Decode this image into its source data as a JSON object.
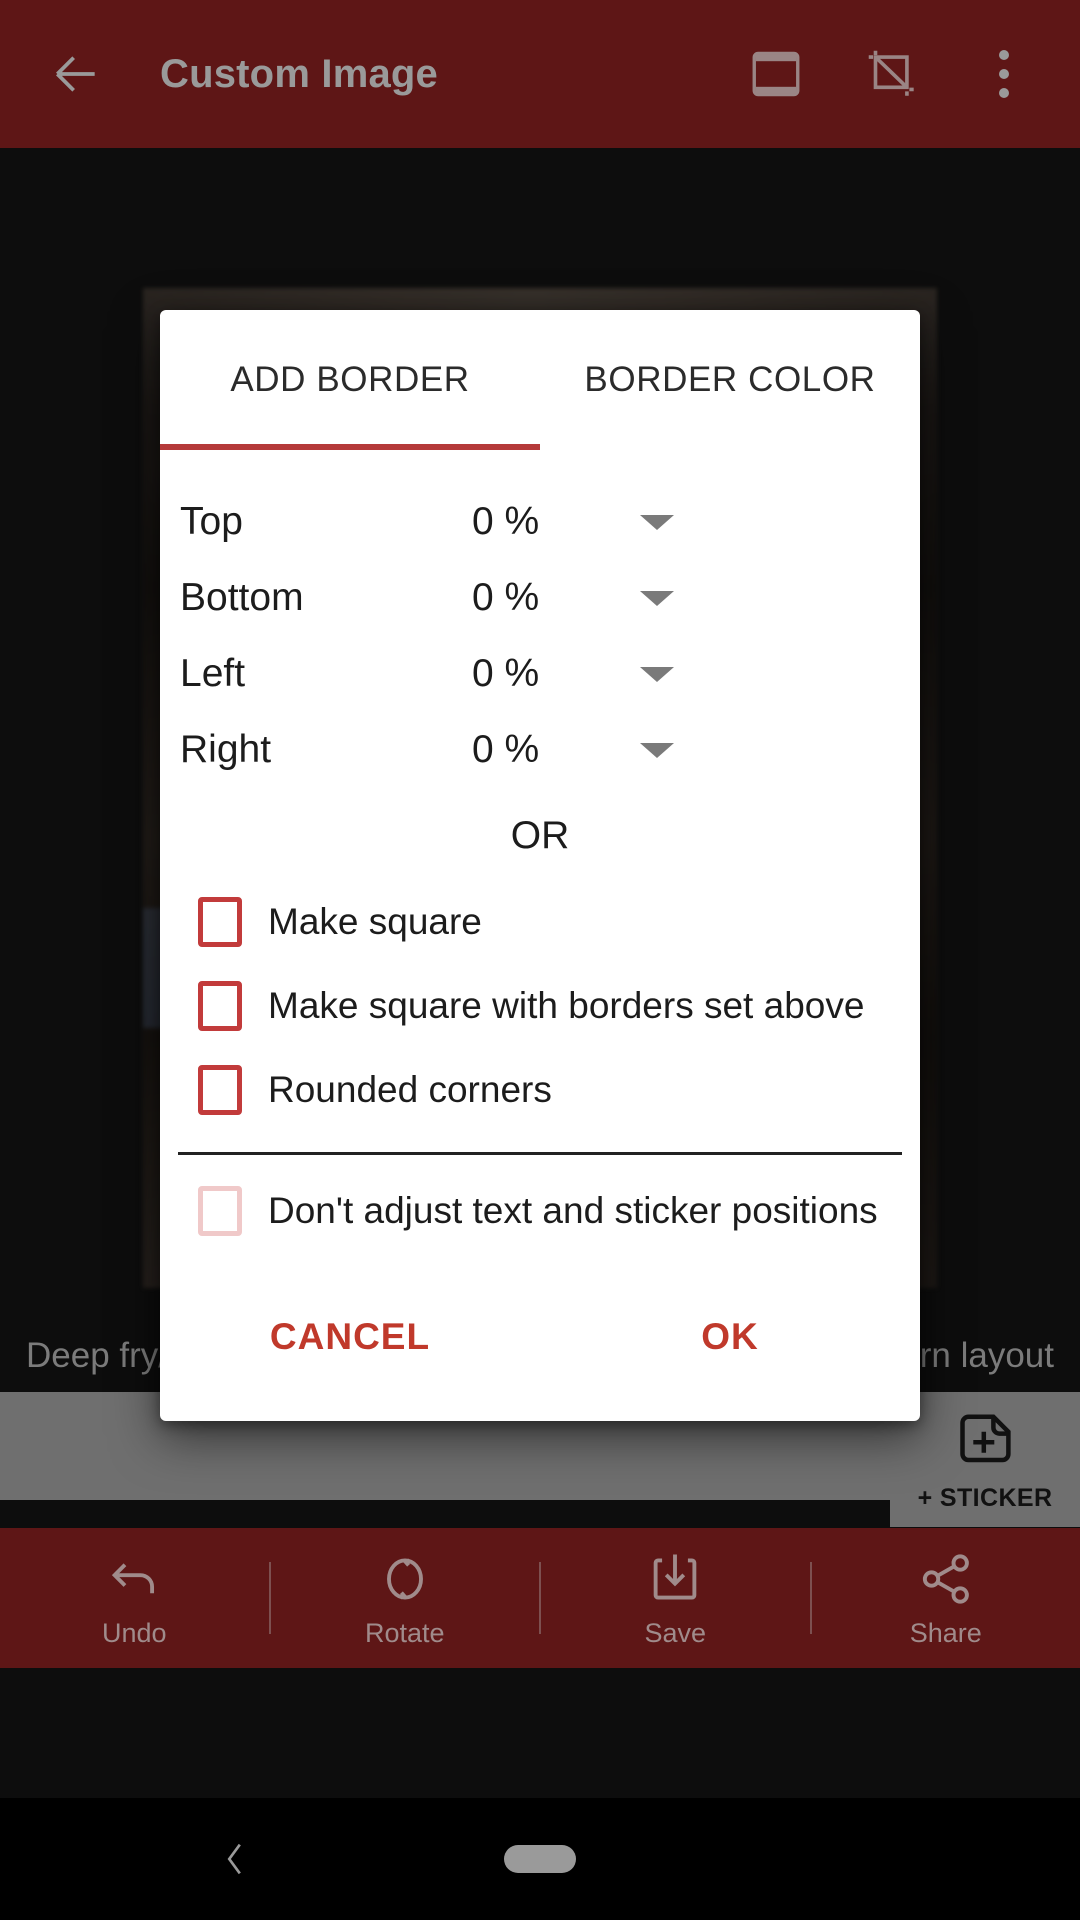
{
  "appbar": {
    "title": "Custom Image",
    "back_icon": "arrow-left-icon",
    "border_icon": "border-frame-icon",
    "crop_icon": "crop-transform-icon",
    "overflow_icon": "more-vertical-icon",
    "background_color": "#5e1616",
    "title_color": "#9a9a9a"
  },
  "canvas": {
    "caption_left": "Deep fry/",
    "caption_right": "rn layout"
  },
  "sticker": {
    "label": "+ STICKER",
    "icon": "add-sticker-icon"
  },
  "dialog": {
    "accent_color": "#b53a3a",
    "action_color": "#c0392b",
    "checkbox_color": "#c23b3b",
    "checkbox_disabled_color": "#f0c9c9",
    "tabs": [
      {
        "label": "ADD BORDER",
        "active": true
      },
      {
        "label": "BORDER COLOR",
        "active": false
      }
    ],
    "border_rows": [
      {
        "label": "Top",
        "value": "0 %",
        "caret": "chevron-down-icon"
      },
      {
        "label": "Bottom",
        "value": "0 %",
        "caret": "chevron-down-icon"
      },
      {
        "label": "Left",
        "value": "0 %",
        "caret": "chevron-down-icon"
      },
      {
        "label": "Right",
        "value": "0 %",
        "caret": "chevron-down-icon"
      }
    ],
    "or_label": "OR",
    "checkboxes": [
      {
        "label": "Make square",
        "checked": false,
        "disabled": false
      },
      {
        "label": "Make square with borders set above",
        "checked": false,
        "disabled": false
      },
      {
        "label": "Rounded corners",
        "checked": false,
        "disabled": false
      }
    ],
    "secondary_checkbox": {
      "label": "Don't adjust text and sticker positions",
      "checked": false,
      "disabled": true
    },
    "cancel_label": "CANCEL",
    "ok_label": "OK"
  },
  "bottombar": {
    "background_color": "#5e1616",
    "items": [
      {
        "label": "Undo",
        "icon": "undo-icon"
      },
      {
        "label": "Rotate",
        "icon": "rotate-icon"
      },
      {
        "label": "Save",
        "icon": "save-download-icon"
      },
      {
        "label": "Share",
        "icon": "share-nodes-icon"
      }
    ]
  },
  "navbar": {
    "back_icon": "nav-back-chevron-icon",
    "home_icon": "nav-home-pill-icon"
  }
}
